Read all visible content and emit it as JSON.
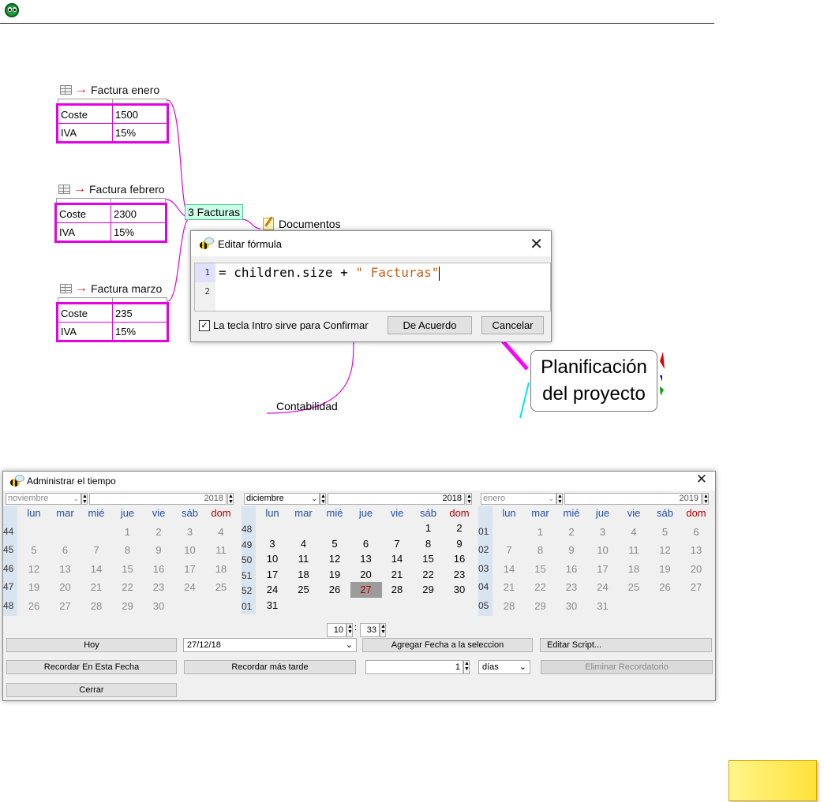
{
  "mindmap": {
    "tables": [
      {
        "title": "Factura enero",
        "rows": [
          [
            "Coste",
            "1500"
          ],
          [
            "IVA",
            "15%"
          ]
        ]
      },
      {
        "title": "Factura febrero",
        "rows": [
          [
            "Coste",
            "2300"
          ],
          [
            "IVA",
            "15%"
          ]
        ]
      },
      {
        "title": "Factura marzo",
        "rows": [
          [
            "Coste",
            "235"
          ],
          [
            "IVA",
            "15%"
          ]
        ]
      }
    ],
    "count_node": "3 Facturas",
    "documents_node": "Documentos",
    "accounting_node": "Contabilidad",
    "planning_node_line1": "Planificación",
    "planning_node_line2": "del proyecto"
  },
  "formula_dialog": {
    "title": "Editar fórmula",
    "line_numbers": [
      "1",
      "2"
    ],
    "code_prefix": "= children.size + ",
    "code_string": "\" Facturas\"",
    "checkbox_label": "La tecla Intro sirve para Confirmar",
    "checkbox_checked": true,
    "ok_label": "De Acuerdo",
    "cancel_label": "Cancelar"
  },
  "time_dialog": {
    "title": "Administrar el tiempo",
    "weekdays": [
      "lun",
      "mar",
      "mié",
      "jue",
      "vie",
      "sáb",
      "dom"
    ],
    "months": [
      {
        "name": "noviembre",
        "year": "2018",
        "weeks": [
          "44",
          "45",
          "46",
          "47",
          "48"
        ],
        "days": [
          [
            "",
            "",
            "",
            "1",
            "2",
            "3",
            "4"
          ],
          [
            "5",
            "6",
            "7",
            "8",
            "9",
            "10",
            "11"
          ],
          [
            "12",
            "13",
            "14",
            "15",
            "16",
            "17",
            "18"
          ],
          [
            "19",
            "20",
            "21",
            "22",
            "23",
            "24",
            "25"
          ],
          [
            "26",
            "27",
            "28",
            "29",
            "30",
            "",
            ""
          ]
        ],
        "active": false
      },
      {
        "name": "diciembre",
        "year": "2018",
        "weeks": [
          "48",
          "49",
          "50",
          "51",
          "52",
          "01"
        ],
        "days": [
          [
            "",
            "",
            "",
            "",
            "",
            "1",
            "2"
          ],
          [
            "3",
            "4",
            "5",
            "6",
            "7",
            "8",
            "9"
          ],
          [
            "10",
            "11",
            "12",
            "13",
            "14",
            "15",
            "16"
          ],
          [
            "17",
            "18",
            "19",
            "20",
            "21",
            "22",
            "23"
          ],
          [
            "24",
            "25",
            "26",
            "27",
            "28",
            "29",
            "30"
          ],
          [
            "31",
            "",
            "",
            "",
            "",
            "",
            ""
          ]
        ],
        "active": true
      },
      {
        "name": "enero",
        "year": "2019",
        "weeks": [
          "01",
          "02",
          "03",
          "04",
          "05"
        ],
        "days": [
          [
            "",
            "1",
            "2",
            "3",
            "4",
            "5",
            "6"
          ],
          [
            "7",
            "8",
            "9",
            "10",
            "11",
            "12",
            "13"
          ],
          [
            "14",
            "15",
            "16",
            "17",
            "18",
            "19",
            "20"
          ],
          [
            "21",
            "22",
            "23",
            "24",
            "25",
            "26",
            "27"
          ],
          [
            "28",
            "29",
            "30",
            "31",
            "",
            "",
            ""
          ]
        ],
        "active": false
      }
    ],
    "selected_day": "27",
    "hour": "10",
    "minute": "33",
    "today_label": "Hoy",
    "date_value": "27/12/18",
    "add_date_label": "Agregar Fecha a la seleccion",
    "edit_script_label": "Editar Script...",
    "remind_on_date_label": "Recordar En Esta Fecha",
    "remind_later_label": "Recordar más tarde",
    "remind_amount": "1",
    "unit_value": "días",
    "remove_reminder_label": "Eliminar Recordatorio",
    "close_label": "Cerrar"
  },
  "colors": {
    "table_border": "#e400e4",
    "weekend": "#b00000",
    "weekday": "#1f4fa8",
    "selected_bg": "#9c9c9c"
  }
}
